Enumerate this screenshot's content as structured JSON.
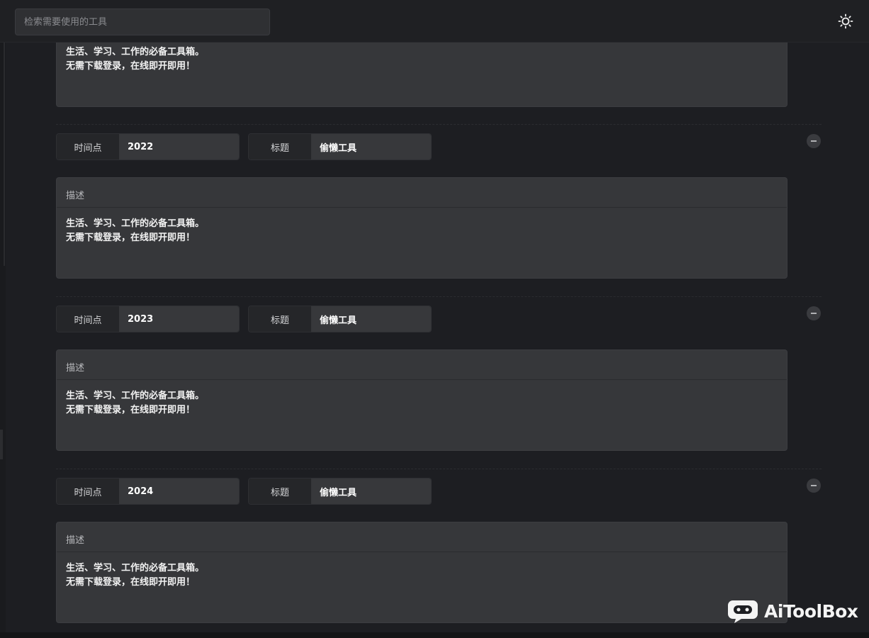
{
  "search": {
    "placeholder": "检索需要使用的工具"
  },
  "icons": {
    "theme": "sun-icon",
    "remove": "minus-circle-icon",
    "logo": "chat-bubble-logo"
  },
  "labels": {
    "time": "时间点",
    "title": "标题",
    "description": "描述"
  },
  "top_partial_description": "生活、学习、工作的必备工具箱。\n无需下载登录，在线即开即用！",
  "entries": [
    {
      "time": "2022",
      "title": "偷懒工具",
      "description": "生活、学习、工作的必备工具箱。\n无需下载登录，在线即开即用！"
    },
    {
      "time": "2023",
      "title": "偷懒工具",
      "description": "生活、学习、工作的必备工具箱。\n无需下载登录，在线即开即用！"
    },
    {
      "time": "2024",
      "title": "偷懒工具",
      "description": "生活、学习、工作的必备工具箱。\n无需下载登录，在线即开即用！"
    }
  ],
  "watermark": "AiToolBox"
}
